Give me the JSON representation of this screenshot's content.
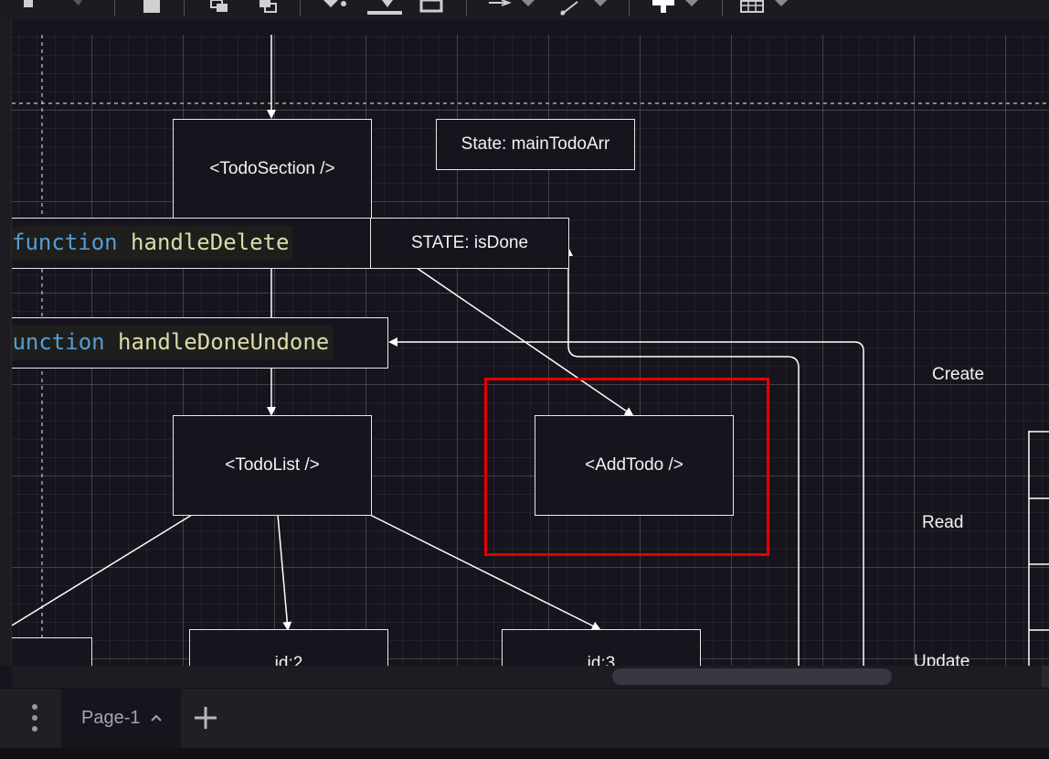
{
  "toolbar": {
    "icons": [
      "undo-icon",
      "redo-icon",
      "delete-icon",
      "to-front-icon",
      "to-back-icon",
      "fill-color-icon",
      "line-color-icon",
      "shadow-icon",
      "connection-icon",
      "waypoints-icon",
      "insert-icon",
      "table-icon"
    ]
  },
  "diagram": {
    "todo_section": "<TodoSection />",
    "state_main": "State: mainTodoArr",
    "handle_delete_keyword": "function",
    "handle_delete_name": "handleDelete",
    "state_is_done": "STATE: isDone",
    "handle_done_keyword": "function",
    "handle_done_name": "handleDoneUndone",
    "todo_list": "<TodoList />",
    "add_todo": "<AddTodo />",
    "item_1": "id:2",
    "item_2": "id:3",
    "label_create": "Create",
    "label_read": "Read",
    "label_update": "Update",
    "selection_color": "#e50000"
  },
  "pages": {
    "tabs": [
      {
        "label": "Page-1"
      }
    ]
  }
}
